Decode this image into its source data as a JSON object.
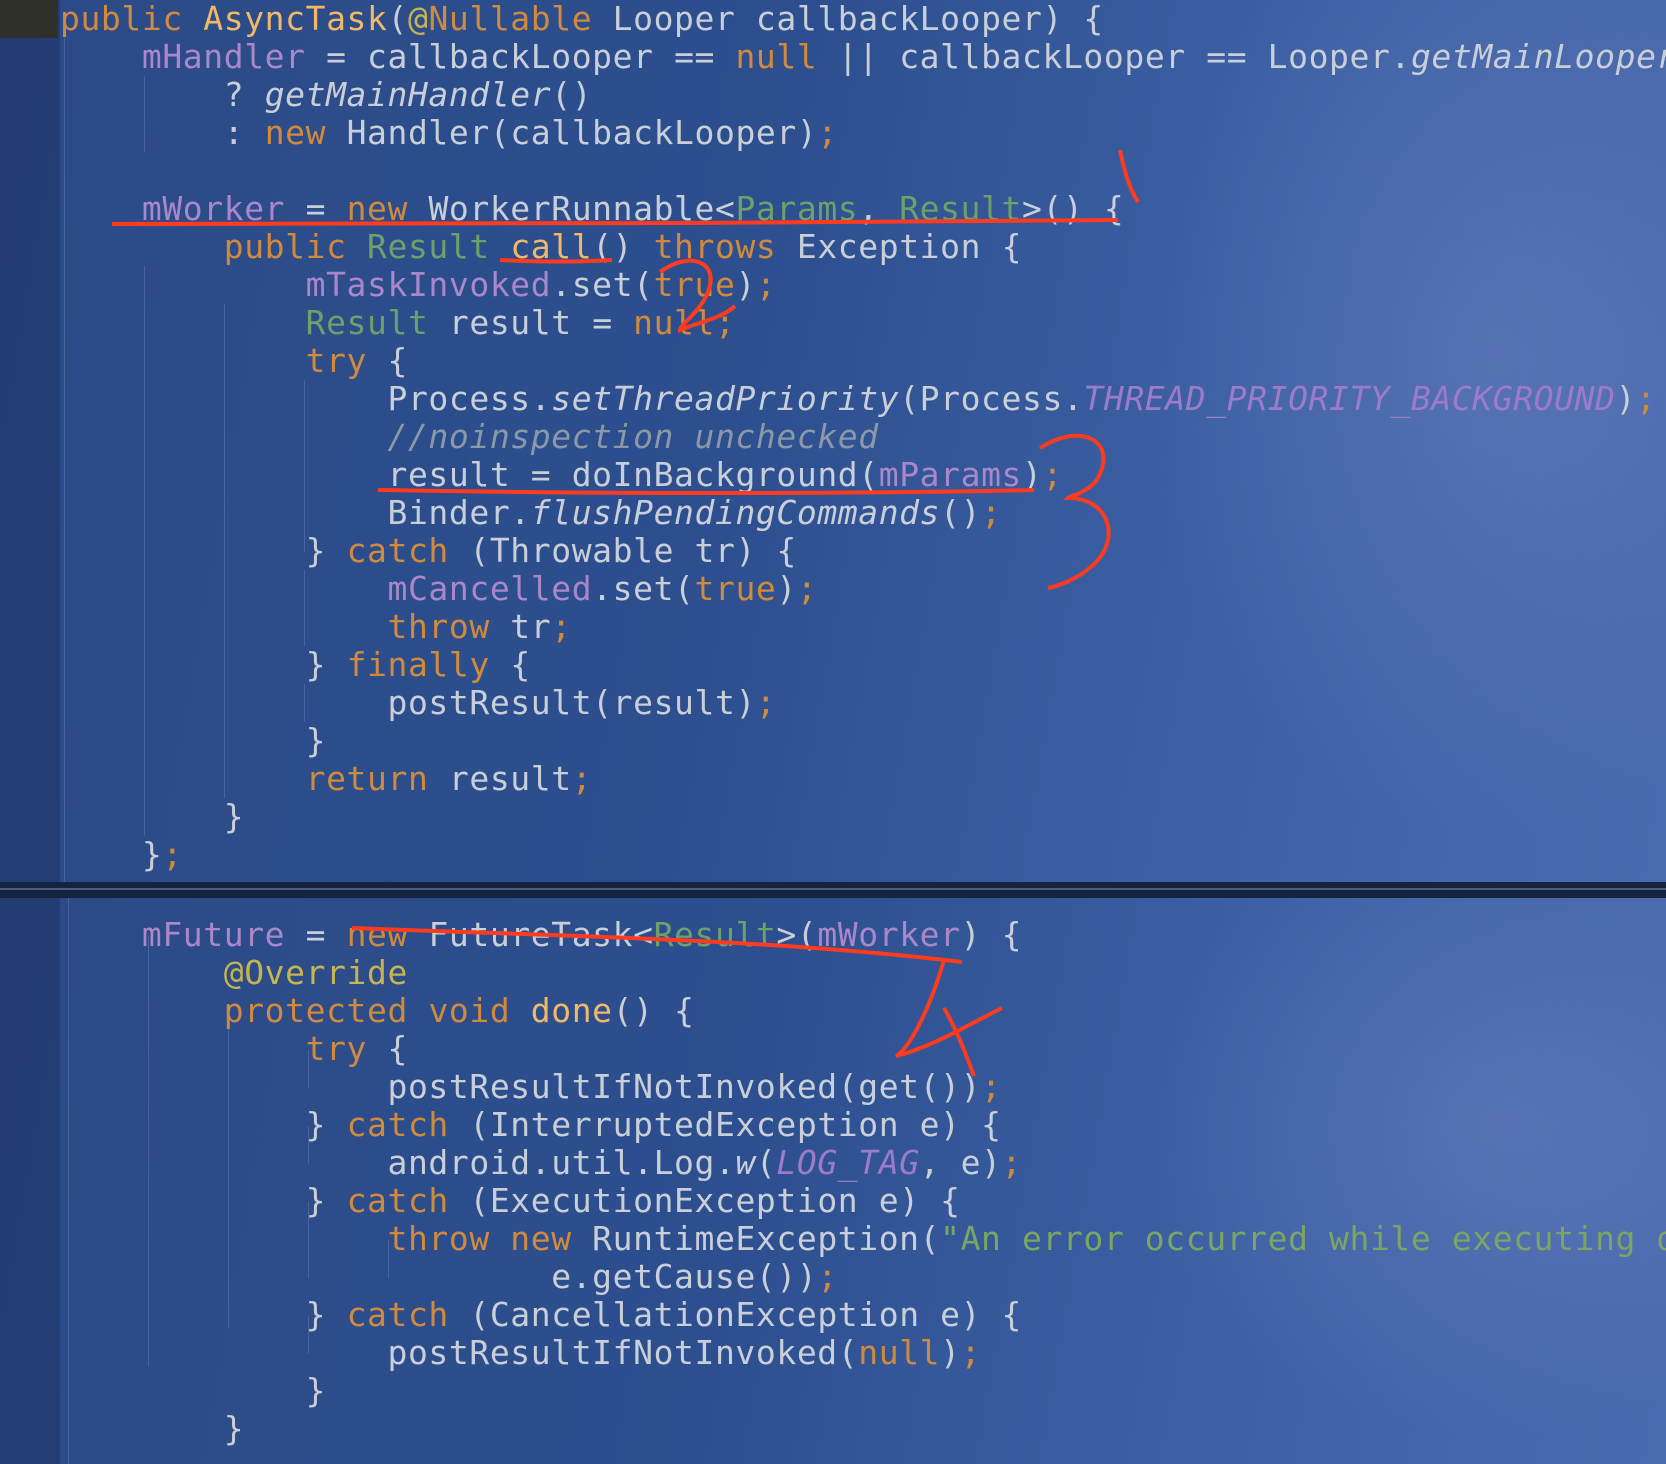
{
  "top_code": [
    "public AsyncTask(@Nullable Looper callbackLooper) {",
    "    mHandler = callbackLooper == null || callbackLooper == Looper.getMainLooper(",
    "        ? getMainHandler()",
    "        : new Handler(callbackLooper);",
    "",
    "    mWorker = new WorkerRunnable<Params, Result>() {",
    "        public Result call() throws Exception {",
    "            mTaskInvoked.set(true);",
    "            Result result = null;",
    "            try {",
    "                Process.setThreadPriority(Process.THREAD_PRIORITY_BACKGROUND);",
    "                //noinspection unchecked",
    "                result = doInBackground(mParams);",
    "                Binder.flushPendingCommands();",
    "            } catch (Throwable tr) {",
    "                mCancelled.set(true);",
    "                throw tr;",
    "            } finally {",
    "                postResult(result);",
    "            }",
    "            return result;",
    "        }",
    "    };"
  ],
  "bottom_code": [
    "    mFuture = new FutureTask<Result>(mWorker) {",
    "        @Override",
    "        protected void done() {",
    "            try {",
    "                postResultIfNotInvoked(get());",
    "            } catch (InterruptedException e) {",
    "                android.util.Log.w(LOG_TAG, e);",
    "            } catch (ExecutionException e) {",
    "                throw new RuntimeException(\"An error occurred while executing do",
    "                        e.getCause());",
    "            } catch (CancellationException e) {",
    "                postResultIfNotInvoked(null);",
    "            }",
    "        }"
  ],
  "annotations": [
    "1",
    "2",
    "3",
    "4"
  ],
  "colors": {
    "background": "#2d4f8f",
    "keyword": "#d08a3e",
    "field": "#a987c9",
    "type_param": "#6f9f6a",
    "annotation_ink": "#ff3b1f"
  }
}
